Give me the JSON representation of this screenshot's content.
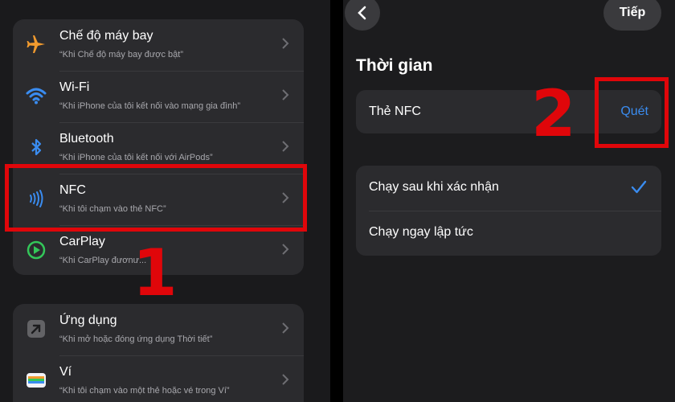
{
  "left": {
    "triggers": [
      {
        "icon": "airplane-icon",
        "title": "Chế độ máy bay",
        "subtitle": "“Khi Chế độ máy bay được bật”"
      },
      {
        "icon": "wifi-icon",
        "title": "Wi-Fi",
        "subtitle": "“Khi iPhone của tôi kết nối vào mạng gia đình”"
      },
      {
        "icon": "bluetooth-icon",
        "title": "Bluetooth",
        "subtitle": "“Khi iPhone của tôi kết nối với AirPods”"
      },
      {
        "icon": "nfc-icon",
        "title": "NFC",
        "subtitle": "“Khi tôi chạm vào thẻ NFC”"
      },
      {
        "icon": "carplay-icon",
        "title": "CarPlay",
        "subtitle": "“Khi CarPlay đươnư..."
      }
    ],
    "apps": [
      {
        "icon": "app-arrow-icon",
        "title": "Ứng dụng",
        "subtitle": "“Khi mở hoặc đóng ứng dụng Thời tiết”"
      },
      {
        "icon": "wallet-icon",
        "title": "Ví",
        "subtitle": "“Khi tôi chạm vào một thẻ hoặc vé trong Ví”"
      }
    ],
    "annotation_number": "1"
  },
  "right": {
    "next_label": "Tiếp",
    "section_title": "Thời gian",
    "nfc_label": "Thẻ NFC",
    "scan_label": "Quét",
    "options": [
      {
        "label": "Chạy sau khi xác nhận",
        "selected": true
      },
      {
        "label": "Chạy ngay lập tức",
        "selected": false
      }
    ],
    "annotation_number": "2"
  },
  "colors": {
    "accent": "#3a8cf0",
    "highlight": "#e0060a",
    "airplane": "#f09a2e",
    "carplay": "#33c759"
  }
}
